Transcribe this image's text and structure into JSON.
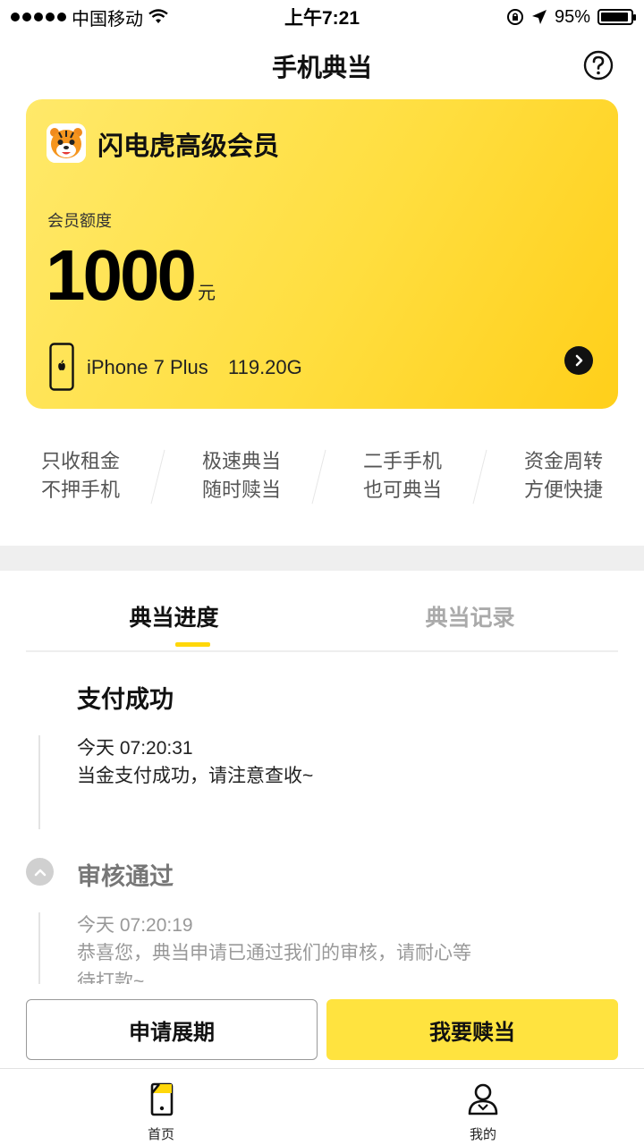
{
  "status_bar": {
    "carrier": "中国移动",
    "time": "上午7:21",
    "battery": "95%",
    "battery_level": 0.95
  },
  "header": {
    "title": "手机典当",
    "help_icon": "question-circle-icon"
  },
  "member_card": {
    "name": "闪电虎高级会员",
    "quota_label": "会员额度",
    "quota_amount": "1000",
    "quota_unit": "元",
    "device_name": "iPhone 7 Plus",
    "device_storage": "119.20G",
    "colors": {
      "start": "#ffe96a",
      "end": "#ffcf1a"
    }
  },
  "features": [
    {
      "line1": "只收租金",
      "line2": "不押手机"
    },
    {
      "line1": "极速典当",
      "line2": "随时赎当"
    },
    {
      "line1": "二手手机",
      "line2": "也可典当"
    },
    {
      "line1": "资金周转",
      "line2": "方便快捷"
    }
  ],
  "tabs": {
    "progress": "典当进度",
    "records": "典当记录",
    "active": "progress"
  },
  "timeline": [
    {
      "title": "支付成功",
      "time": "今天 07:20:31",
      "desc": "当金支付成功，请注意查收~"
    },
    {
      "title": "审核通过",
      "time": "今天 07:20:19",
      "desc": "恭喜您，典当申请已通过我们的审核，请耐心等待打款~"
    }
  ],
  "actions": {
    "extend": "申请展期",
    "redeem": "我要赎当"
  },
  "tab_bar": {
    "home": "首页",
    "mine": "我的"
  },
  "colors": {
    "accent": "#ffe33f",
    "indicator": "#ffd70a"
  }
}
